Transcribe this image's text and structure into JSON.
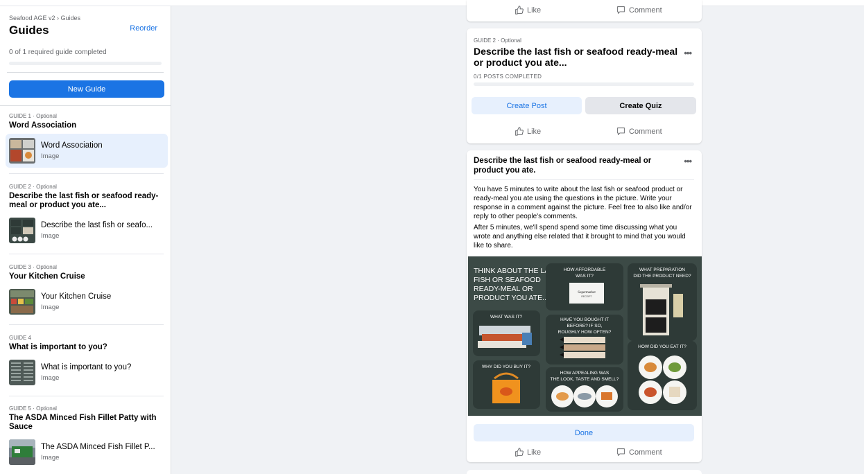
{
  "sidebar": {
    "breadcrumb": "Seafood AGE v2 › Guides",
    "title": "Guides",
    "reorder_label": "Reorder",
    "progress_text": "0 of 1 required guide completed",
    "new_guide_label": "New Guide",
    "guides": [
      {
        "meta": "GUIDE 1 · Optional",
        "title": "Word Association",
        "item_title": "Word Association",
        "item_type": "Image"
      },
      {
        "meta": "GUIDE 2 · Optional",
        "title": "Describe the last fish or seafood ready-meal or product you ate...",
        "item_title": "Describe the last fish or seafo...",
        "item_type": "Image"
      },
      {
        "meta": "GUIDE 3 · Optional",
        "title": "Your Kitchen Cruise",
        "item_title": "Your Kitchen Cruise",
        "item_type": "Image"
      },
      {
        "meta": "GUIDE 4",
        "title": "What is important to you?",
        "item_title": "What is important to you?",
        "item_type": "Image"
      },
      {
        "meta": "GUIDE 5 · Optional",
        "title": "The ASDA Minced Fish Fillet Patty with Sauce",
        "item_title": "The ASDA Minced Fish Fillet P...",
        "item_type": "Image"
      }
    ]
  },
  "feed": {
    "like_label": "Like",
    "comment_label": "Comment",
    "guide_card": {
      "meta": "GUIDE 2 · Optional",
      "title": "Describe the last fish or seafood ready-meal or product you ate...",
      "posts_completed": "0/1 POSTS COMPLETED",
      "create_post_label": "Create Post",
      "create_quiz_label": "Create Quiz"
    },
    "post_card": {
      "title": "Describe the last fish or seafood ready-meal or product you ate.",
      "paragraph1": "You have 5 minutes to write about the last fish or seafood product or ready-meal you ate using the questions in the picture. Write your response in a comment against the picture. Feel free to also like and/or reply to other people's comments.",
      "paragraph2": "After 5 minutes, we'll spend spend some time discussing what you wrote and anything else related that it brought to mind that you would like to share.",
      "done_label": "Done"
    },
    "infographic": {
      "intro_line1": "THINK ABOUT THE LAST",
      "intro_line2": "FISH OR SEAFOOD",
      "intro_line3": "READY-MEAL OR",
      "intro_line4": "PRODUCT YOU ATE...",
      "q_affordable_1": "HOW AFFORDABLE",
      "q_affordable_2": "WAS IT?",
      "receipt_1": "Supermarket",
      "receipt_2": "RECEIPT",
      "q_prep_1": "WHAT PREPARATION",
      "q_prep_2": "DID THE PRODUCT NEED?",
      "q_what": "WHAT WAS IT?",
      "q_bought_1": "HAVE YOU BOUGHT IT",
      "q_bought_2": "BEFORE? IF SO,",
      "q_bought_3": "ROUGHLY HOW OFTEN?",
      "q_eat": "HOW DID YOU EAT IT?",
      "q_why": "WHY DID YOU BUY IT?",
      "q_appeal_1": "HOW APPEALING WAS",
      "q_appeal_2": "THE LOOK, TASTE AND SMELL?"
    }
  },
  "colors": {
    "accent": "#1b74e4",
    "accent_light": "#e7f0fd",
    "infographic_bg": "#3c4a46",
    "tile_bg": "#2e3a37"
  }
}
